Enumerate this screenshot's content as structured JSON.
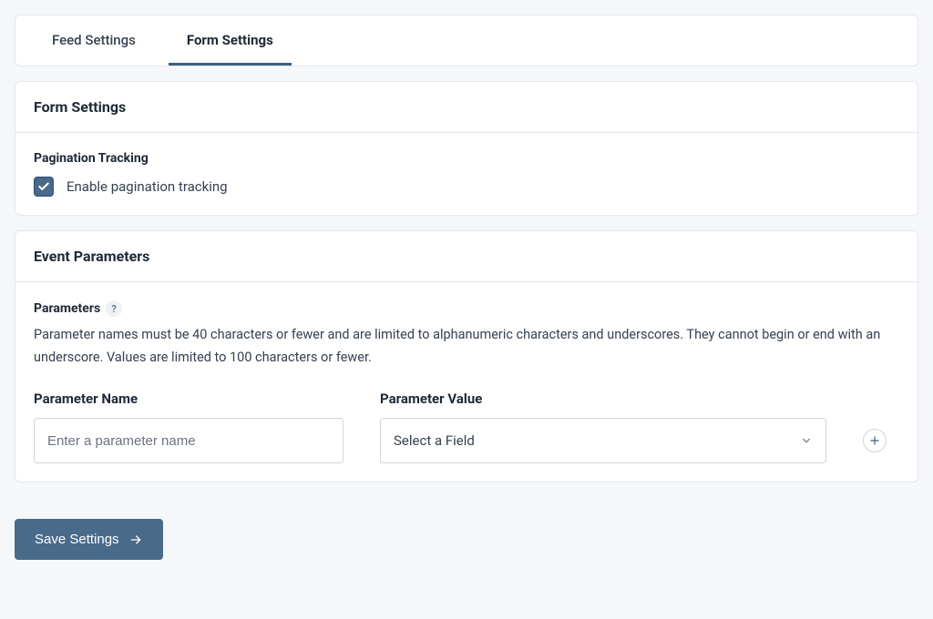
{
  "tabs": {
    "feed": "Feed Settings",
    "form": "Form Settings"
  },
  "formSettings": {
    "heading": "Form Settings",
    "paginationLabel": "Pagination Tracking",
    "paginationCheckboxLabel": "Enable pagination tracking",
    "paginationChecked": true
  },
  "eventParams": {
    "heading": "Event Parameters",
    "parametersLabel": "Parameters",
    "helpSymbol": "?",
    "description": "Parameter names must be 40 characters or fewer and are limited to alphanumeric characters and underscores. They cannot begin or end with an underscore. Values are limited to 100 characters or fewer.",
    "nameHeading": "Parameter Name",
    "namePlaceholder": "Enter a parameter name",
    "valueHeading": "Parameter Value",
    "valuePlaceholder": "Select a Field"
  },
  "actions": {
    "save": "Save Settings"
  }
}
